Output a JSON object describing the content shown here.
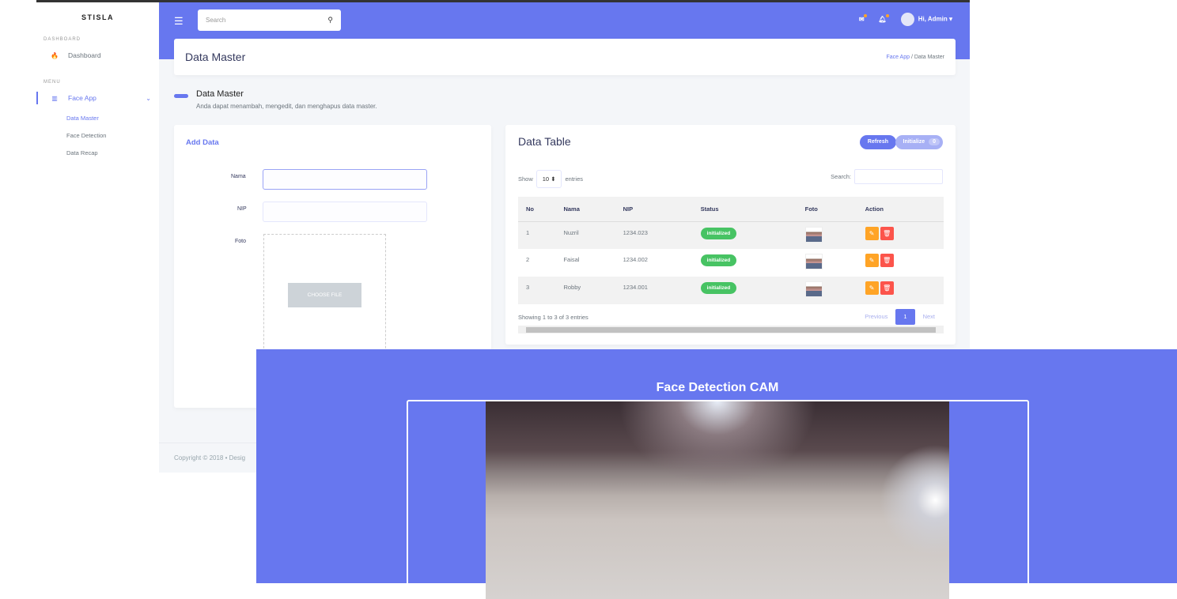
{
  "sidebar": {
    "brand": "STISLA",
    "sections": [
      "DASHBOARD",
      "MENU"
    ],
    "dashboard": "Dashboard",
    "face_app": "Face App",
    "sub": [
      "Data Master",
      "Face Detection",
      "Data Recap"
    ]
  },
  "topbar": {
    "search_placeholder": "Search",
    "user": "Hi, Admin"
  },
  "header": {
    "title": "Data Master",
    "breadcrumb": [
      "Face App",
      "Data Master"
    ],
    "separator": "/"
  },
  "section": {
    "title": "Data Master",
    "desc": "Anda dapat menambah, mengedit, dan menghapus data master."
  },
  "form": {
    "title": "Add Data",
    "nama": "Nama",
    "nip": "NIP",
    "foto": "Foto",
    "choose": "CHOOSE FILE"
  },
  "table": {
    "title": "Data Table",
    "refresh": "Refresh",
    "initialize": "Initialize",
    "init_count": "0",
    "show": "Show",
    "entries_value": "10",
    "entries": "entries",
    "search": "Search:",
    "columns": [
      "No",
      "Nama",
      "NIP",
      "Status",
      "Foto",
      "Action"
    ],
    "rows": [
      {
        "no": "1",
        "nama": "Nuzril",
        "nip": "1234.023",
        "status": "initialized"
      },
      {
        "no": "2",
        "nama": "Faisal",
        "nip": "1234.002",
        "status": "initialized"
      },
      {
        "no": "3",
        "nama": "Robby",
        "nip": "1234.001",
        "status": "initialized"
      }
    ],
    "info": "Showing 1 to 3 of 3 entries",
    "prev": "Previous",
    "page": "1",
    "next": "Next"
  },
  "footer": {
    "text": "Copyright © 2018  •  Desig"
  },
  "cam": {
    "title": "Face Detection CAM"
  },
  "colors": {
    "primary": "#6777ef",
    "success": "#47c363",
    "warning": "#ffa426",
    "danger": "#fc544b"
  }
}
